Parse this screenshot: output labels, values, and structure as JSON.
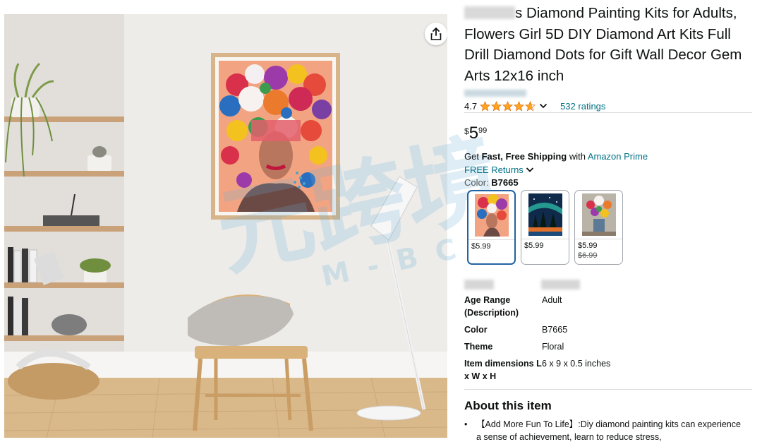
{
  "product": {
    "title_prefix": "s Diamond Painting Kits for",
    "title_rest": "Adults, Flowers Girl 5D DIY Diamond Art Kits Full Drill Diamond Dots for Gift Wall Decor Gem Arts 12x16 inch",
    "rating_value": "4.7",
    "rating_stars": 4.7,
    "ratings_count": "532 ratings",
    "price_symbol": "$",
    "price_whole": "5",
    "price_fraction": "99"
  },
  "shipping": {
    "prefix": "Get ",
    "bold": "Fast, Free Shipping",
    "middle": " with ",
    "prime": "Amazon Prime",
    "returns": "FREE Returns"
  },
  "color_selector": {
    "label": "Color: ",
    "selected": "B7665",
    "options": [
      {
        "price": "$5.99",
        "old_price": ""
      },
      {
        "price": "$5.99",
        "old_price": ""
      },
      {
        "price": "$5.99",
        "old_price": "$6.99"
      }
    ]
  },
  "specs": [
    {
      "key": "Age Range (Description)",
      "value": "Adult"
    },
    {
      "key": "Color",
      "value": "B7665"
    },
    {
      "key": "Theme",
      "value": "Floral"
    },
    {
      "key": "Item dimensions L x W x H",
      "value": "6 x 9 x 0.5 inches"
    }
  ],
  "about": {
    "title": "About this item",
    "bullet_1": "【Add More Fun To Life】:Diy diamond painting kits can experience a sense of achievement, learn to reduce stress,"
  },
  "watermark": {
    "chars": "元跨境",
    "sub": "M - B C S"
  },
  "colors": {
    "link": "#007185",
    "star": "#FFA41C",
    "selected_border": "#2162a1"
  }
}
